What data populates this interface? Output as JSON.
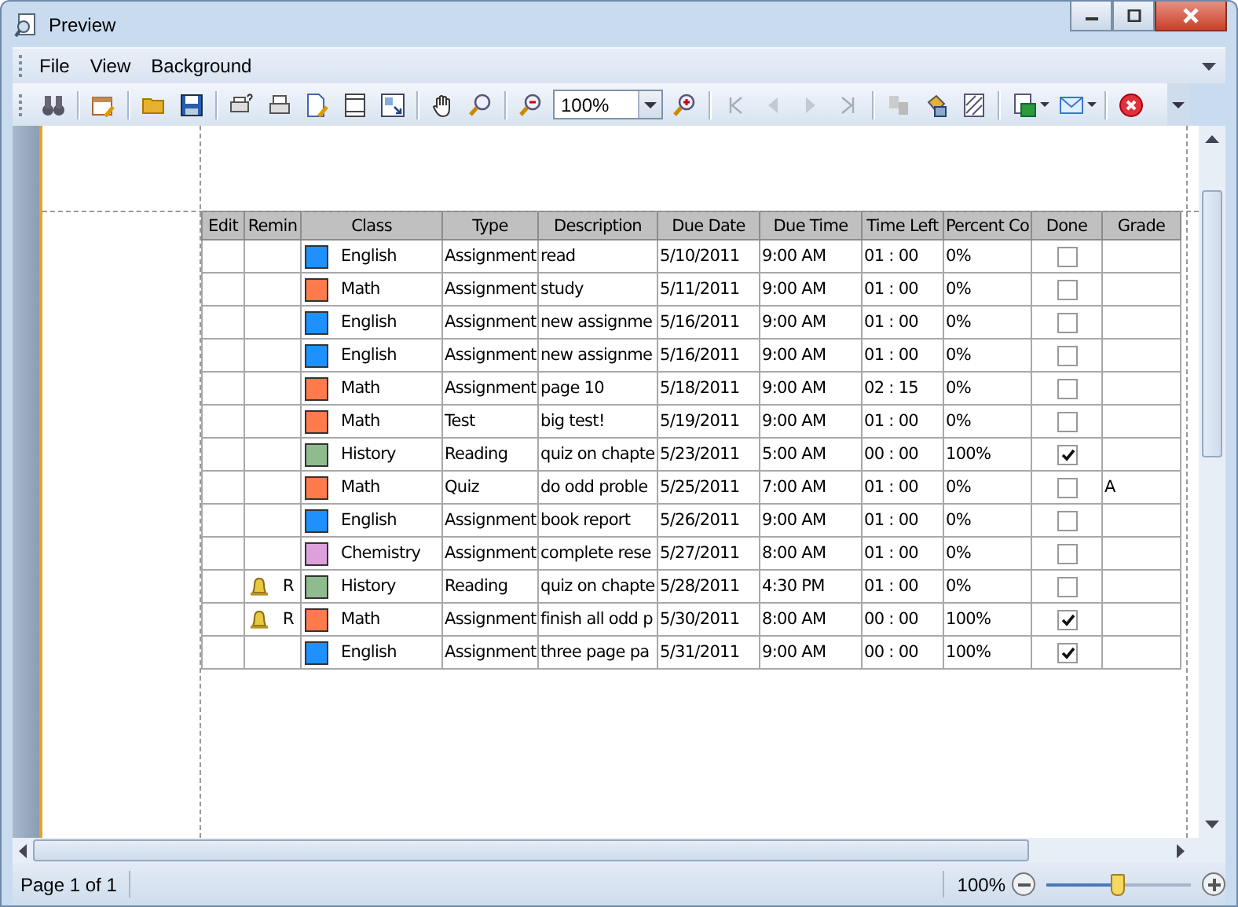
{
  "window": {
    "title": "Preview"
  },
  "menu": [
    "File",
    "View",
    "Background"
  ],
  "toolbar": {
    "zoom_value": "100%"
  },
  "table": {
    "columns": [
      "Edit",
      "Remin",
      "Class",
      "Type",
      "Description",
      "Due Date",
      "Due Time",
      "Time Left",
      "Percent Co",
      "Done",
      "Grade"
    ],
    "rows": [
      {
        "reminder": "",
        "class": {
          "name": "English",
          "color": "#1e90ff"
        },
        "type": "Assignment",
        "description": "read",
        "due_date": "5/10/2011",
        "due_time": "9:00 AM",
        "time_left": "01 : 00",
        "percent": "0%",
        "done": false,
        "grade": ""
      },
      {
        "reminder": "",
        "class": {
          "name": "Math",
          "color": "#ff7a4d"
        },
        "type": "Assignment",
        "description": "study",
        "due_date": "5/11/2011",
        "due_time": "9:00 AM",
        "time_left": "01 : 00",
        "percent": "0%",
        "done": false,
        "grade": ""
      },
      {
        "reminder": "",
        "class": {
          "name": "English",
          "color": "#1e90ff"
        },
        "type": "Assignment",
        "description": "new assignme",
        "due_date": "5/16/2011",
        "due_time": "9:00 AM",
        "time_left": "01 : 00",
        "percent": "0%",
        "done": false,
        "grade": ""
      },
      {
        "reminder": "",
        "class": {
          "name": "English",
          "color": "#1e90ff"
        },
        "type": "Assignment",
        "description": "new assignme",
        "due_date": "5/16/2011",
        "due_time": "9:00 AM",
        "time_left": "01 : 00",
        "percent": "0%",
        "done": false,
        "grade": ""
      },
      {
        "reminder": "",
        "class": {
          "name": "Math",
          "color": "#ff7a4d"
        },
        "type": "Assignment",
        "description": "page 10",
        "due_date": "5/18/2011",
        "due_time": "9:00 AM",
        "time_left": "02 : 15",
        "percent": "0%",
        "done": false,
        "grade": ""
      },
      {
        "reminder": "",
        "class": {
          "name": "Math",
          "color": "#ff7a4d"
        },
        "type": "Test",
        "description": "big test!",
        "due_date": "5/19/2011",
        "due_time": "9:00 AM",
        "time_left": "01 : 00",
        "percent": "0%",
        "done": false,
        "grade": ""
      },
      {
        "reminder": "",
        "class": {
          "name": "History",
          "color": "#8fbc8f"
        },
        "type": "Reading",
        "description": "quiz on chapte",
        "due_date": "5/23/2011",
        "due_time": "5:00 AM",
        "time_left": "00 : 00",
        "percent": "100%",
        "done": true,
        "grade": ""
      },
      {
        "reminder": "",
        "class": {
          "name": "Math",
          "color": "#ff7a4d"
        },
        "type": "Quiz",
        "description": "do odd proble",
        "due_date": "5/25/2011",
        "due_time": "7:00 AM",
        "time_left": "01 : 00",
        "percent": "0%",
        "done": false,
        "grade": "A"
      },
      {
        "reminder": "",
        "class": {
          "name": "English",
          "color": "#1e90ff"
        },
        "type": "Assignment",
        "description": "book report",
        "due_date": "5/26/2011",
        "due_time": "9:00 AM",
        "time_left": "01 : 00",
        "percent": "0%",
        "done": false,
        "grade": ""
      },
      {
        "reminder": "",
        "class": {
          "name": "Chemistry",
          "color": "#dda0dd"
        },
        "type": "Assignment",
        "description": "complete rese",
        "due_date": "5/27/2011",
        "due_time": "8:00 AM",
        "time_left": "01 : 00",
        "percent": "0%",
        "done": false,
        "grade": ""
      },
      {
        "reminder": "R",
        "class": {
          "name": "History",
          "color": "#8fbc8f"
        },
        "type": "Reading",
        "description": "quiz on chapte",
        "due_date": "5/28/2011",
        "due_time": "4:30 PM",
        "time_left": "01 : 00",
        "percent": "0%",
        "done": false,
        "grade": ""
      },
      {
        "reminder": "R",
        "class": {
          "name": "Math",
          "color": "#ff7a4d"
        },
        "type": "Assignment",
        "description": "finish all odd p",
        "due_date": "5/30/2011",
        "due_time": "8:00 AM",
        "time_left": "00 : 00",
        "percent": "100%",
        "done": true,
        "grade": ""
      },
      {
        "reminder": "",
        "class": {
          "name": "English",
          "color": "#1e90ff"
        },
        "type": "Assignment",
        "description": "three page pa",
        "due_date": "5/31/2011",
        "due_time": "9:00 AM",
        "time_left": "00 : 00",
        "percent": "100%",
        "done": true,
        "grade": ""
      }
    ]
  },
  "status_bar": {
    "page": "Page 1 of 1",
    "zoom": "100%",
    "zoom_slider": {
      "level": 0.5
    }
  }
}
